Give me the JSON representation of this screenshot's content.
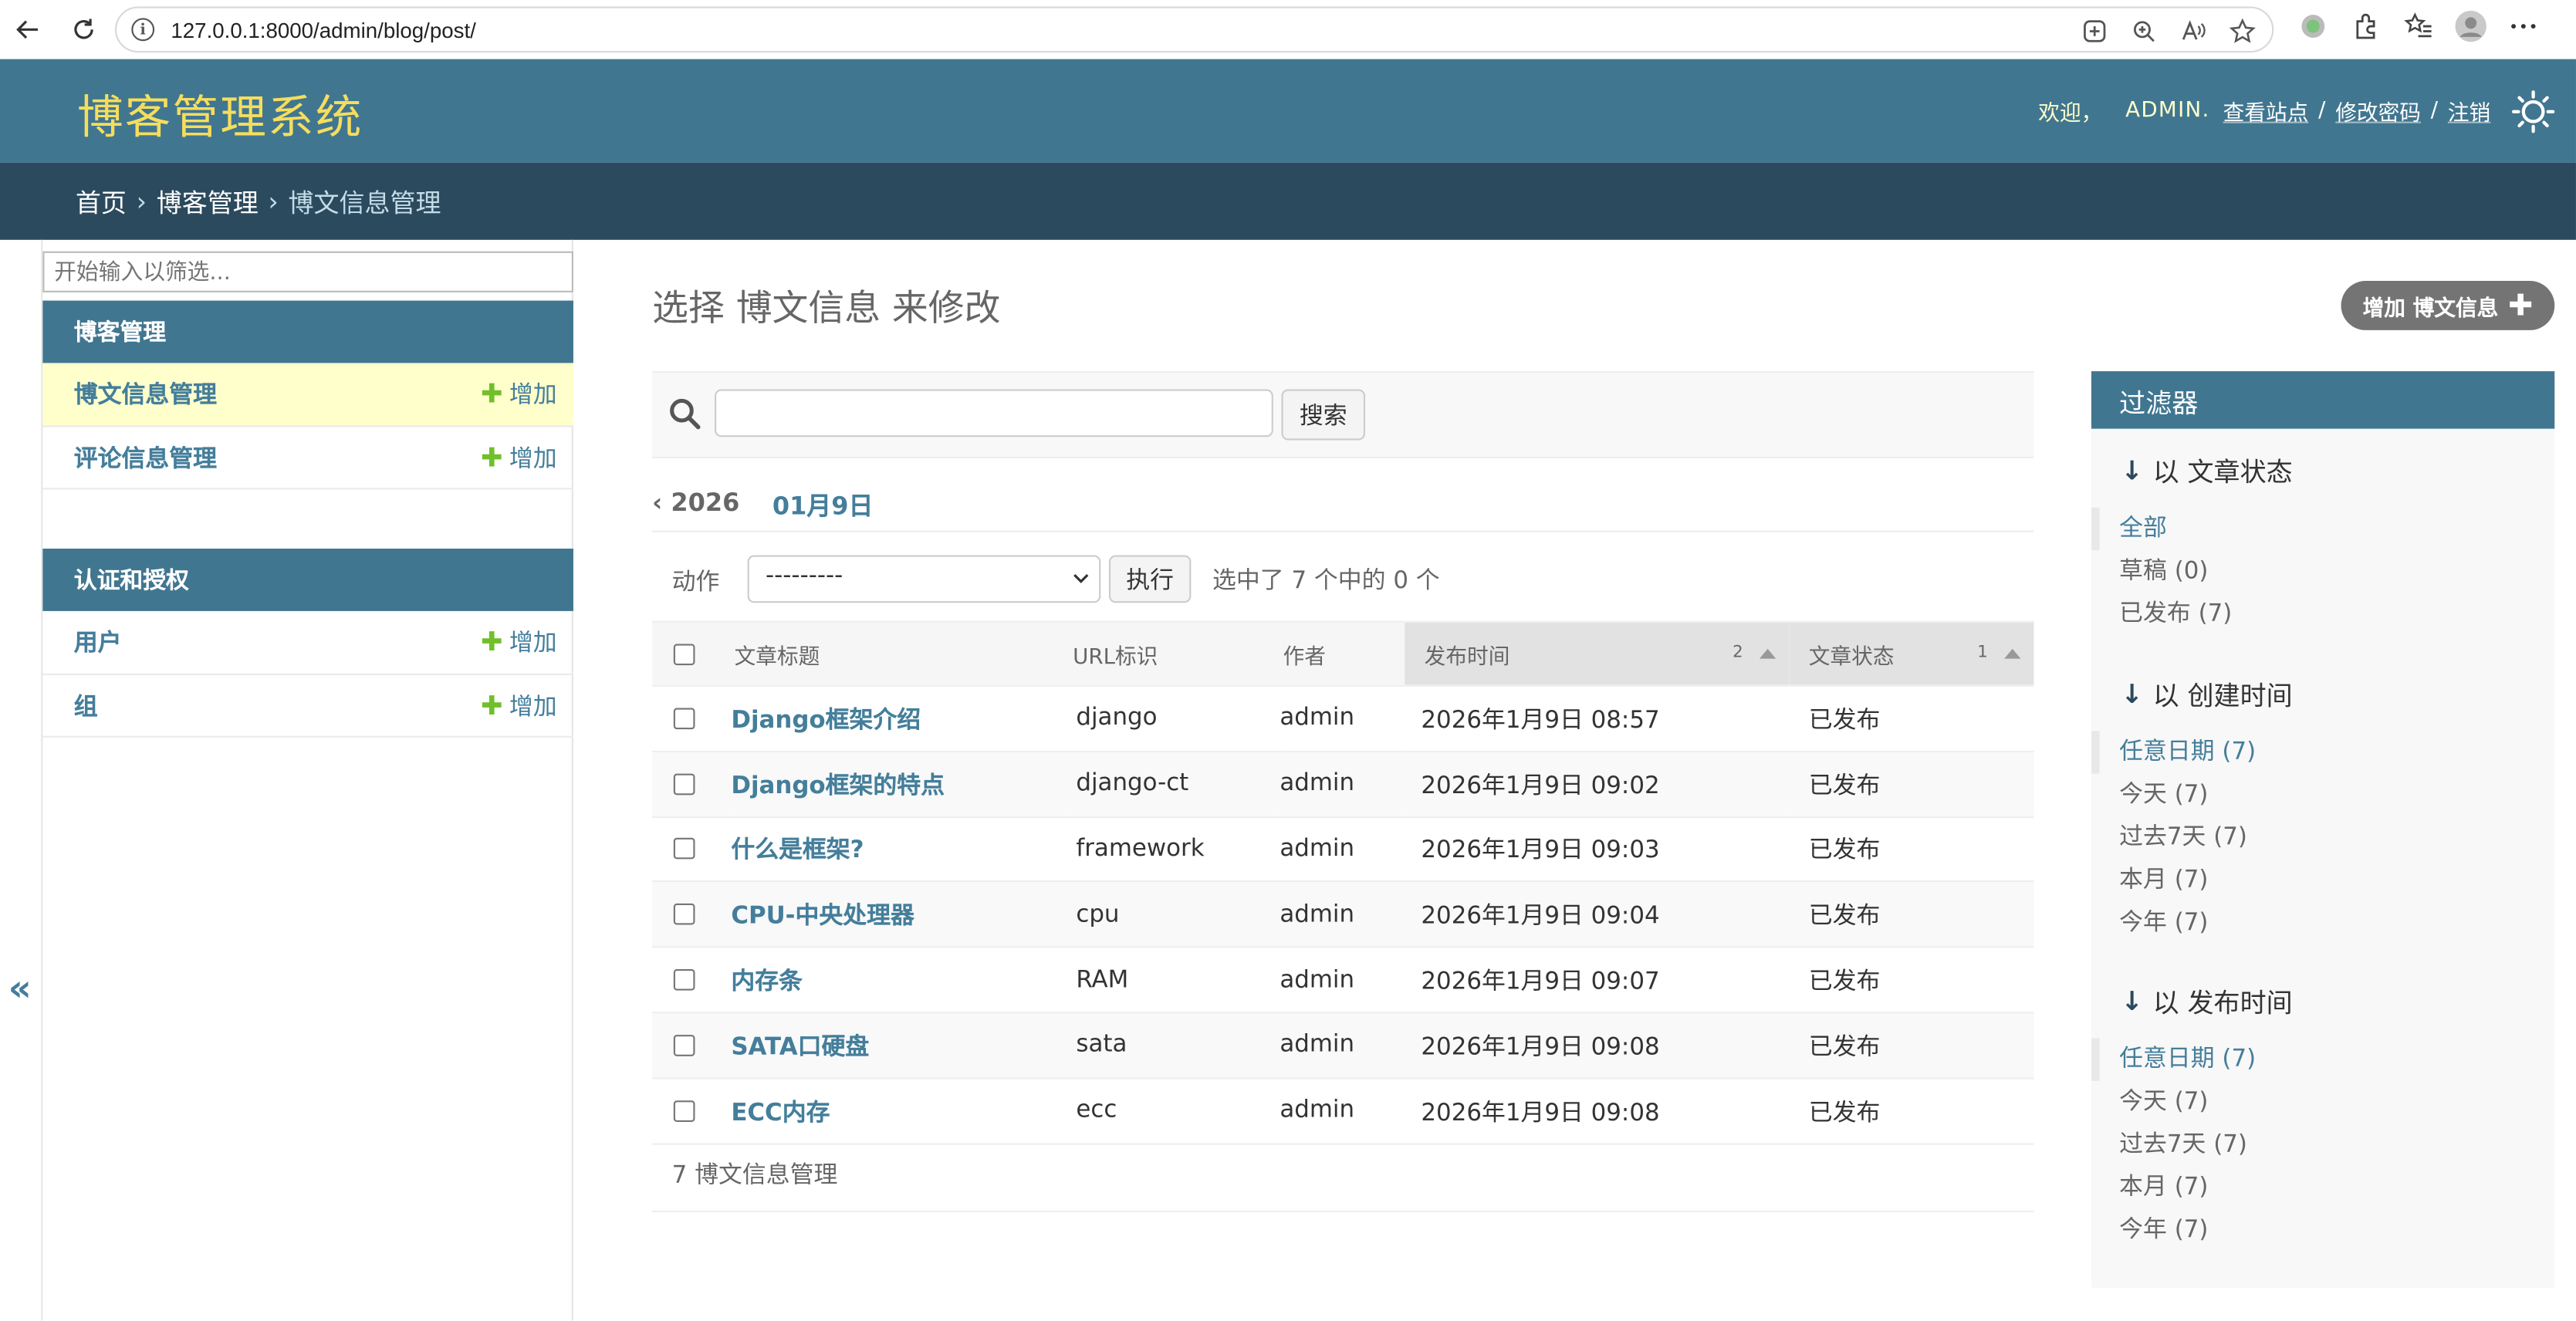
{
  "browser": {
    "url": "127.0.0.1:8000/admin/blog/post/"
  },
  "header": {
    "brand": "博客管理系统",
    "welcome": "欢迎，",
    "username": "ADMIN.",
    "view_site": "查看站点",
    "change_password": "修改密码",
    "logout": "注销",
    "separator": "/"
  },
  "breadcrumbs": {
    "home": "首页",
    "app": "博客管理",
    "current": "博文信息管理",
    "sep": "›"
  },
  "sidebar": {
    "filter_placeholder": "开始输入以筛选...",
    "modules": [
      {
        "caption": "博客管理",
        "rows": [
          {
            "name": "博文信息管理",
            "add": "增加"
          },
          {
            "name": "评论信息管理",
            "add": "增加"
          }
        ]
      },
      {
        "caption": "认证和授权",
        "rows": [
          {
            "name": "用户",
            "add": "增加"
          },
          {
            "name": "组",
            "add": "增加"
          }
        ]
      }
    ],
    "collapse_label": "«"
  },
  "main": {
    "title": "选择 博文信息 来修改",
    "add_button": "增加 博文信息",
    "search_button": "搜索",
    "date_back": "‹ 2026",
    "date_current": "01月9日",
    "action_label": "动作",
    "action_selected": "---------",
    "go_button": "执行",
    "selection_counter": "选中了 7 个中的 0 个",
    "columns": [
      "文章标题",
      "URL标识",
      "作者",
      "发布时间",
      "文章状态"
    ],
    "sort_priority": {
      "publish_time": "2",
      "status": "1"
    },
    "rows": [
      {
        "title": "Django框架介绍",
        "slug": "django",
        "author": "admin",
        "publish": "2026年1月9日 08:57",
        "status": "已发布"
      },
      {
        "title": "Django框架的特点",
        "slug": "django-ct",
        "author": "admin",
        "publish": "2026年1月9日 09:02",
        "status": "已发布"
      },
      {
        "title": "什么是框架?",
        "slug": "framework",
        "author": "admin",
        "publish": "2026年1月9日 09:03",
        "status": "已发布"
      },
      {
        "title": "CPU-中央处理器",
        "slug": "cpu",
        "author": "admin",
        "publish": "2026年1月9日 09:04",
        "status": "已发布"
      },
      {
        "title": "内存条",
        "slug": "RAM",
        "author": "admin",
        "publish": "2026年1月9日 09:07",
        "status": "已发布"
      },
      {
        "title": "SATA口硬盘",
        "slug": "sata",
        "author": "admin",
        "publish": "2026年1月9日 09:08",
        "status": "已发布"
      },
      {
        "title": "ECC内存",
        "slug": "ecc",
        "author": "admin",
        "publish": "2026年1月9日 09:08",
        "status": "已发布"
      }
    ],
    "paginator": "7 博文信息管理"
  },
  "filter": {
    "title": "过滤器",
    "groups": [
      {
        "heading": "以 文章状态",
        "items": [
          "全部",
          "草稿 (0)",
          "已发布 (7)"
        ],
        "selected": 0
      },
      {
        "heading": "以 创建时间",
        "items": [
          "任意日期 (7)",
          "今天 (7)",
          "过去7天 (7)",
          "本月 (7)",
          "今年 (7)"
        ],
        "selected": 0
      },
      {
        "heading": "以 发布时间",
        "items": [
          "任意日期 (7)",
          "今天 (7)",
          "过去7天 (7)",
          "本月 (7)",
          "今年 (7)"
        ],
        "selected": 0
      }
    ]
  },
  "colors": {
    "header_bg": "#417690",
    "breadcrumb_bg": "#2c4a5e",
    "brand": "#f5dd5d",
    "link": "#447e9b",
    "add_green": "#70bf2b",
    "active_row": "#ffffcc"
  }
}
